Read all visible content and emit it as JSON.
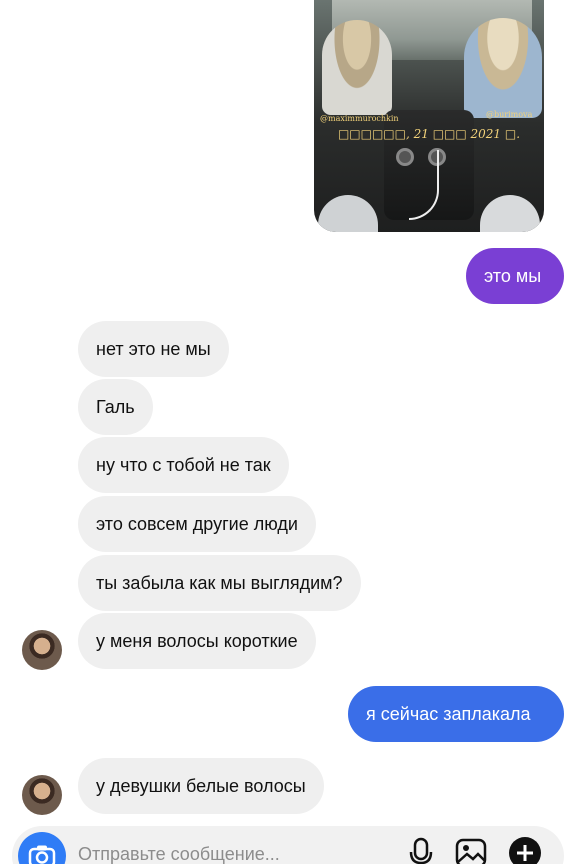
{
  "photo": {
    "handle_left": "@maximmurochkin",
    "handle_right": "@burimova",
    "date_text": "□□□□□□, 21 □□□ 2021 □."
  },
  "messages": [
    {
      "id": "m1",
      "direction": "out",
      "text": "это мы",
      "color": "#7a3fd4"
    },
    {
      "id": "m2",
      "direction": "in",
      "text": "нет это не мы"
    },
    {
      "id": "m3",
      "direction": "in",
      "text": "Галь"
    },
    {
      "id": "m4",
      "direction": "in",
      "text": "ну что с тобой не так"
    },
    {
      "id": "m5",
      "direction": "in",
      "text": "это совсем другие люди"
    },
    {
      "id": "m6",
      "direction": "in",
      "text": "ты забыла как мы выглядим?"
    },
    {
      "id": "m7",
      "direction": "in",
      "text": "у меня волосы короткие"
    },
    {
      "id": "m8",
      "direction": "out",
      "text": "я сейчас заплакала",
      "color": "#3a6ee8"
    },
    {
      "id": "m9",
      "direction": "in",
      "text": "у девушки белые волосы"
    }
  ],
  "composer": {
    "placeholder": "Отправьте сообщение...",
    "accent": "#2f7cf6",
    "icons": [
      "camera-icon",
      "microphone-icon",
      "gallery-icon",
      "plus-icon"
    ]
  },
  "colors": {
    "incoming_bubble": "#efefef",
    "outgoing_purple": "#7a3fd4",
    "outgoing_blue": "#3a6ee8"
  }
}
